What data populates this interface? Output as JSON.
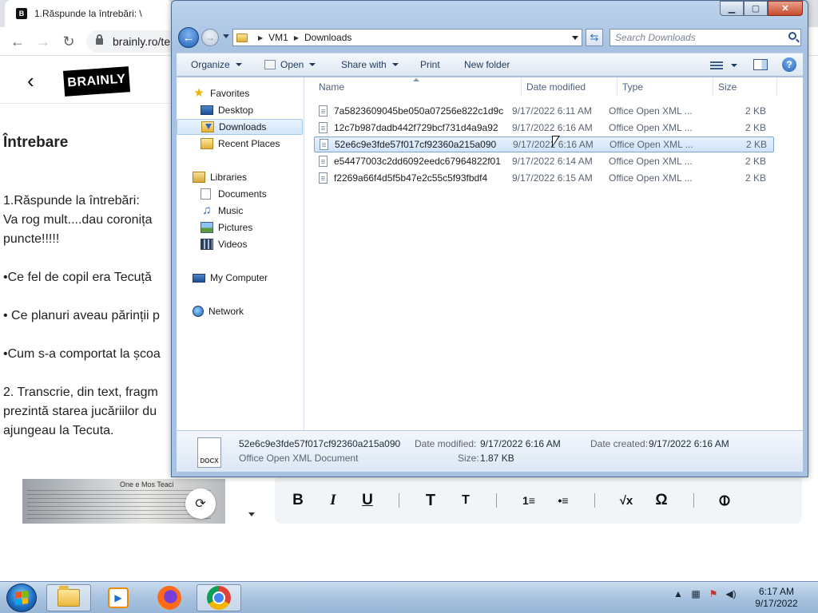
{
  "browser": {
    "tab_title": "1.Răspunde la întrebări: \\",
    "favicon_letter": "B",
    "url": "brainly.ro/te",
    "icons": [
      "back-arrow-icon",
      "forward-arrow-icon",
      "reload-icon",
      "lock-icon"
    ]
  },
  "brainly": {
    "logo": "BRAINLY",
    "heading": "Întrebare",
    "question_lines": [
      "1.Răspunde la întrebări:",
      "Va rog mult....dau coronița",
      "puncte!!!!!",
      "",
      "•Ce fel de copil era Tecuță",
      "",
      "• Ce planuri aveau părinții p",
      "",
      "•Cum s-a comportat la școa",
      "",
      "2. Transcrie, din text, fragm",
      "prezintă starea jucăriilor du",
      "ajungeau la Tecuta."
    ],
    "image_caption": "One e Mos Teaci"
  },
  "editor_toolbar": {
    "buttons": [
      {
        "name": "bold-button",
        "glyph": "B"
      },
      {
        "name": "italic-button",
        "glyph": "I"
      },
      {
        "name": "underline-button",
        "glyph": "U"
      },
      {
        "name": "heading-large-button",
        "glyph": "T"
      },
      {
        "name": "heading-small-button",
        "glyph": "T"
      },
      {
        "name": "numbered-list-button",
        "glyph": "1≡"
      },
      {
        "name": "bullet-list-button",
        "glyph": "•≡"
      },
      {
        "name": "math-button",
        "glyph": "√x"
      },
      {
        "name": "symbol-button",
        "glyph": "Ω"
      },
      {
        "name": "attach-button",
        "glyph": "⊘"
      }
    ]
  },
  "explorer": {
    "window_buttons": {
      "minimize": "▁",
      "maximize": "▢",
      "close": "✕"
    },
    "breadcrumb": [
      "VM1",
      "Downloads"
    ],
    "search_placeholder": "Search Downloads",
    "commands": {
      "organize": "Organize",
      "open": "Open",
      "share": "Share with",
      "print": "Print",
      "new_folder": "New folder"
    },
    "nav": {
      "favorites": "Favorites",
      "desktop": "Desktop",
      "downloads": "Downloads",
      "recent": "Recent Places",
      "libraries": "Libraries",
      "documents": "Documents",
      "music": "Music",
      "pictures": "Pictures",
      "videos": "Videos",
      "computer": "My Computer",
      "network": "Network"
    },
    "columns": {
      "name": "Name",
      "date": "Date modified",
      "type": "Type",
      "size": "Size"
    },
    "files": [
      {
        "name": "7a5823609045be050a07256e822c1d9c",
        "date": "9/17/2022 6:11 AM",
        "type": "Office Open XML ...",
        "size": "2 KB"
      },
      {
        "name": "12c7b987dadb442f729bcf731d4a9a92",
        "date": "9/17/2022 6:16 AM",
        "type": "Office Open XML ...",
        "size": "2 KB"
      },
      {
        "name": "52e6c9e3fde57f017cf92360a215a090",
        "date": "9/17/2022 6:16 AM",
        "type": "Office Open XML ...",
        "size": "2 KB"
      },
      {
        "name": "e54477003c2dd6092eedc67964822f01",
        "date": "9/17/2022 6:14 AM",
        "type": "Office Open XML ...",
        "size": "2 KB"
      },
      {
        "name": "f2269a66f4d5f5b47e2c55c5f93fbdf4",
        "date": "9/17/2022 6:15 AM",
        "type": "Office Open XML ...",
        "size": "2 KB"
      }
    ],
    "selected_index": 2,
    "details": {
      "filename": "52e6c9e3fde57f017cf92360a215a090",
      "filetype": "Office Open XML Document",
      "modified_label": "Date modified:",
      "modified_value": "9/17/2022 6:16 AM",
      "created_label": "Date created:",
      "created_value": "9/17/2022 6:16 AM",
      "size_label": "Size:",
      "size_value": "1.87 KB",
      "icon_text": "DOCX"
    }
  },
  "taskbar": {
    "time": "6:17 AM",
    "date": "9/17/2022"
  }
}
